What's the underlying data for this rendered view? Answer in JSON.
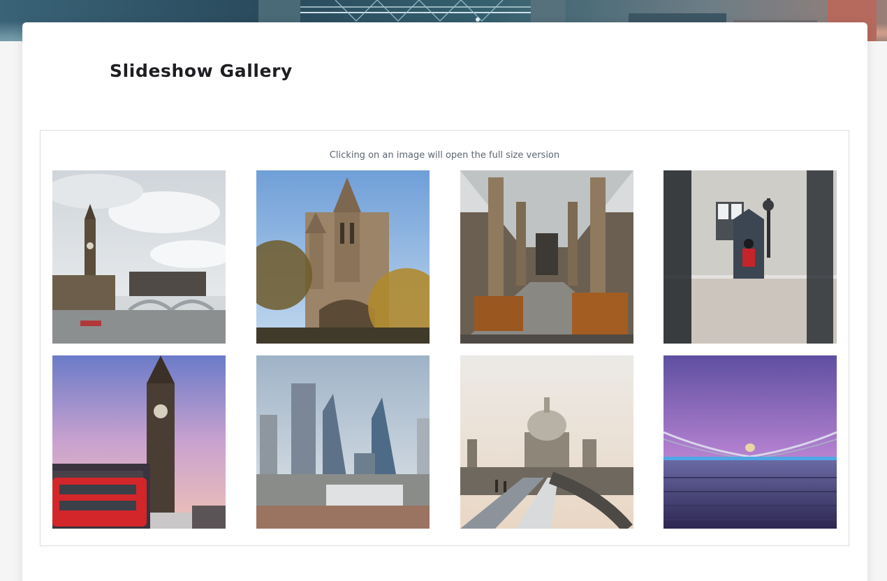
{
  "page": {
    "title": "Slideshow Gallery"
  },
  "gallery": {
    "hint": "Clicking on an image will open the full size version",
    "images": [
      {
        "subject": "Big Ben and Westminster Bridge under cloudy sky"
      },
      {
        "subject": "Natural History Museum towers with autumn tree"
      },
      {
        "subject": "Library interior with pillars and wooden desks"
      },
      {
        "subject": "Royal guard in red tunic beside sentry box"
      },
      {
        "subject": "Big Ben at dusk with red double-decker bus"
      },
      {
        "subject": "City of London skyscrapers and construction cranes"
      },
      {
        "subject": "St Paul's Cathedral dome from Millennium Bridge"
      },
      {
        "subject": "Millennium Bridge at twilight with purple sky"
      }
    ]
  },
  "colors": {
    "title": "#1e1e22",
    "hint": "#5c6670",
    "border": "#dcdfe3"
  }
}
